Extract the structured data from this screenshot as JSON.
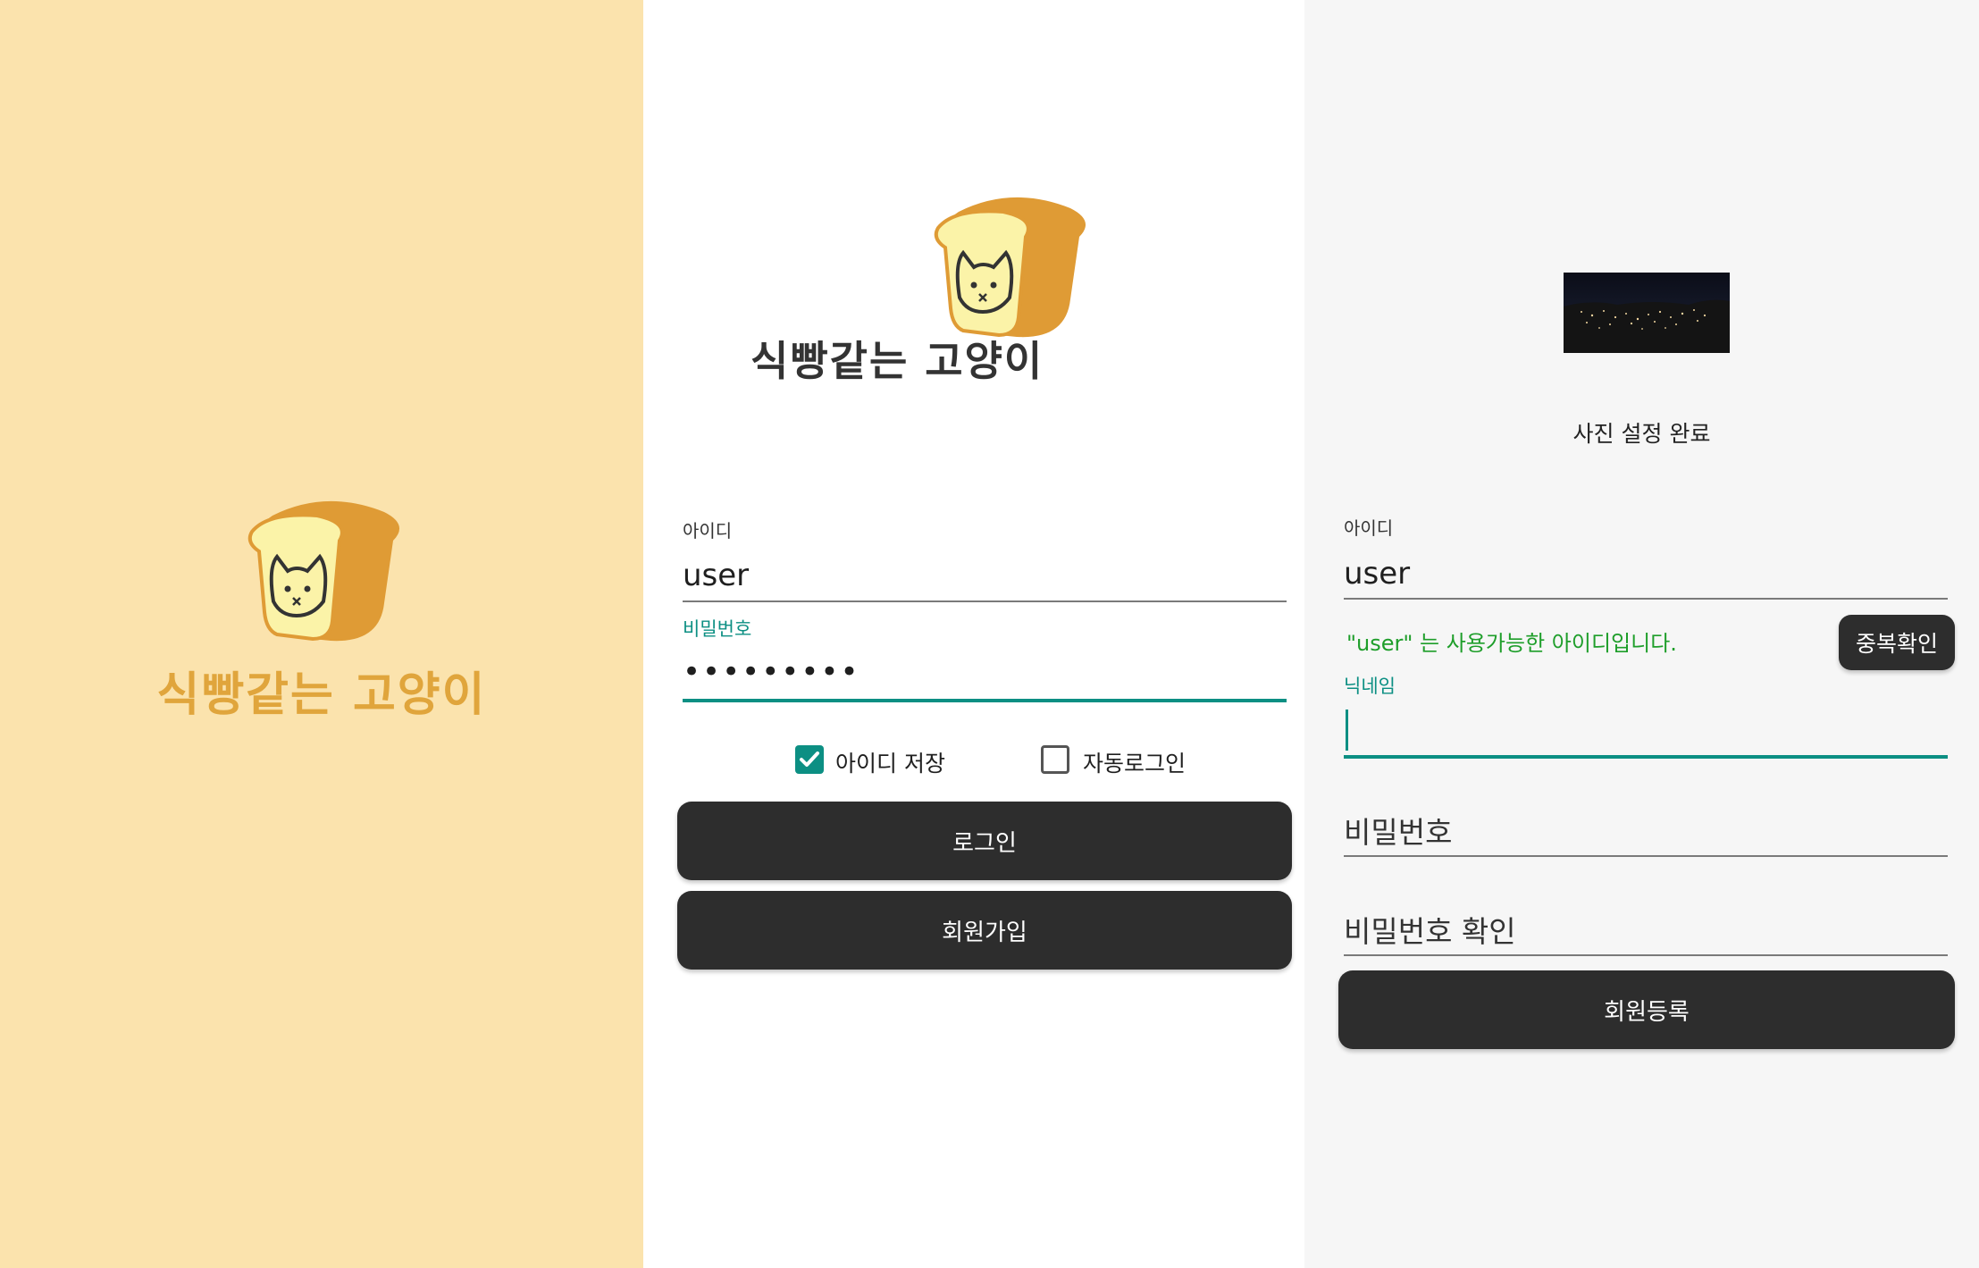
{
  "splash": {
    "logo_text": "식빵같는 고양이"
  },
  "login": {
    "logo_text": "식빵같는 고양이",
    "id_label": "아이디",
    "id_value": "user",
    "password_label": "비밀번호",
    "password_value": "•••••••••",
    "save_id_label": "아이디 저장",
    "save_id_checked": true,
    "auto_login_label": "자동로그인",
    "auto_login_checked": false,
    "login_button": "로그인",
    "signup_button": "회원가입"
  },
  "signup": {
    "photo_status": "사진 설정 완료",
    "id_label": "아이디",
    "id_value": "user",
    "id_available_message": "\"user\" 는 사용가능한 아이디입니다.",
    "duplicate_check_button": "중복확인",
    "nickname_label": "닉네임",
    "nickname_value": "",
    "password_placeholder": "비밀번호",
    "password_confirm_placeholder": "비밀번호 확인",
    "register_button": "회원등록"
  },
  "colors": {
    "splash_background": "#fbe3ad",
    "accent_teal": "#0c8f83",
    "button_dark": "#2d2d2d",
    "success_green": "#1e9e2a",
    "logo_orange": "#e0a53c"
  }
}
